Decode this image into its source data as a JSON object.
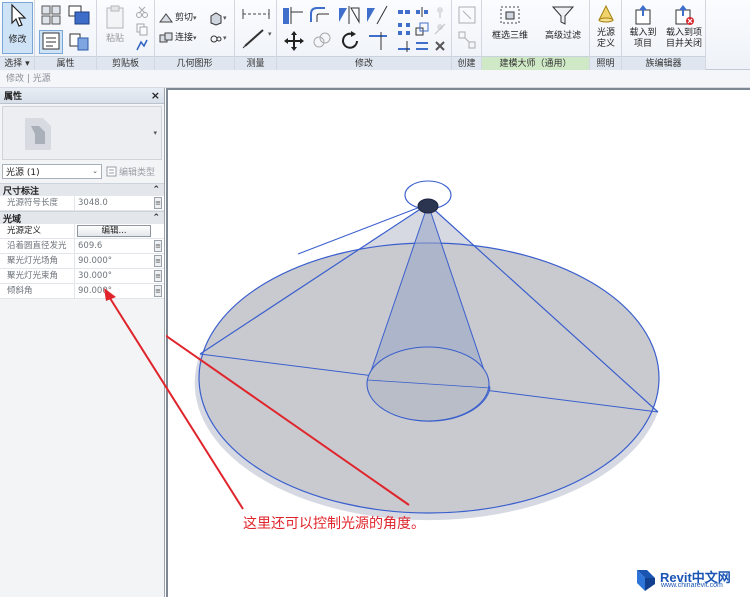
{
  "ribbon": {
    "select": {
      "modify_label": "修改",
      "select_label": "选择 ▾"
    },
    "properties": {
      "label": "属性"
    },
    "clipboard": {
      "paste_label": "粘贴",
      "label": "剪贴板"
    },
    "geometry": {
      "cut_label": "剪切",
      "join_label": "连接",
      "label": "几何图形"
    },
    "measure": {
      "label": "测量"
    },
    "modify": {
      "label": "修改"
    },
    "create": {
      "label": "创建"
    },
    "modeling_master": {
      "filter_3d_label": "框选三维",
      "advanced_filter_label": "高级过滤",
      "label": "建模大师（通用）"
    },
    "lighting": {
      "light_source_def_label": "光源定义",
      "label": "照明"
    },
    "family_editor": {
      "load_into_project_label": "载入到项目",
      "load_and_close_label": "载入到项目并关闭",
      "label": "族编辑器"
    }
  },
  "context_bar": {
    "text": "修改 | 光源"
  },
  "properties": {
    "title": "属性",
    "close": "×",
    "type_name": "光源 (1)",
    "edit_type_label": "编辑类型",
    "groups": [
      {
        "name": "尺寸标注",
        "rows": [
          {
            "name": "光源符号长度",
            "value": "3048.0"
          }
        ]
      },
      {
        "name": "光域",
        "rows": [
          {
            "name": "光源定义",
            "value": "",
            "button": "编辑..."
          },
          {
            "name": "沿着圆直径发光",
            "value": "609.6"
          },
          {
            "name": "聚光灯光场角",
            "value": "90.000°"
          },
          {
            "name": "聚光灯光束角",
            "value": "30.000°"
          },
          {
            "name": "倾斜角",
            "value": "90.000°"
          }
        ]
      }
    ]
  },
  "annotation": {
    "text": "这里还可以控制光源的角度。",
    "color": "#e0242b"
  },
  "logo": {
    "main": "Revit中文网",
    "sub": "www.chinarevit.com",
    "color": "#1a55b4"
  },
  "colors": {
    "accent": "#3a5fcd",
    "cone_fill": "#c9ceda"
  }
}
